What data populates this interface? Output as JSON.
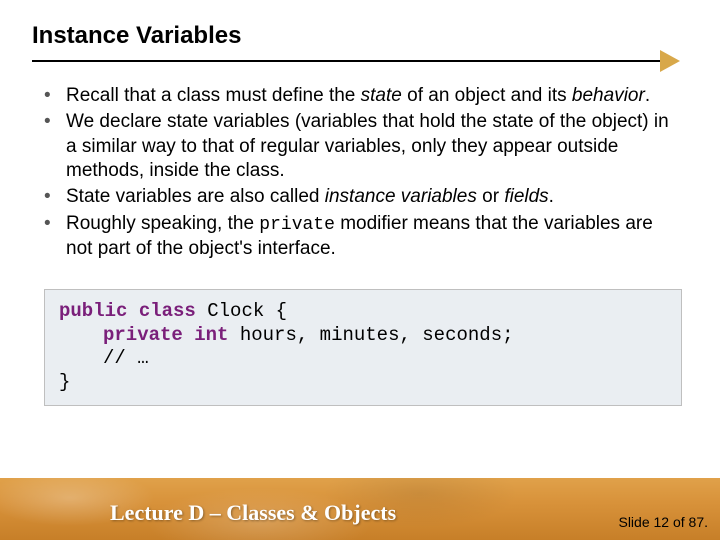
{
  "title": "Instance Variables",
  "bullets": {
    "b1a": "Recall that a class must define the ",
    "b1_state": "state",
    "b1b": " of an object and its ",
    "b1_behavior": "behavior",
    "b1c": ".",
    "b2": "We declare state variables (variables that hold the state of the object) in a similar way to that of regular variables, only they appear outside methods, inside the class.",
    "b3a": "State variables are also called ",
    "b3_iv": "instance variables",
    "b3b": " or ",
    "b3_fields": "fields",
    "b3c": ".",
    "b4a": "Roughly speaking, the ",
    "b4_private": "private",
    "b4b": " modifier means that the variables are not part of the object's interface."
  },
  "code": {
    "kw_public": "public",
    "kw_class": "class",
    "name_clock": " Clock {",
    "kw_private": "private",
    "kw_int": "int",
    "fields": " hours, minutes, seconds;",
    "comment": "// …",
    "close": "}"
  },
  "footer": {
    "lecture": "Lecture D – Classes & Objects",
    "slide": "Slide 12 of 87."
  }
}
